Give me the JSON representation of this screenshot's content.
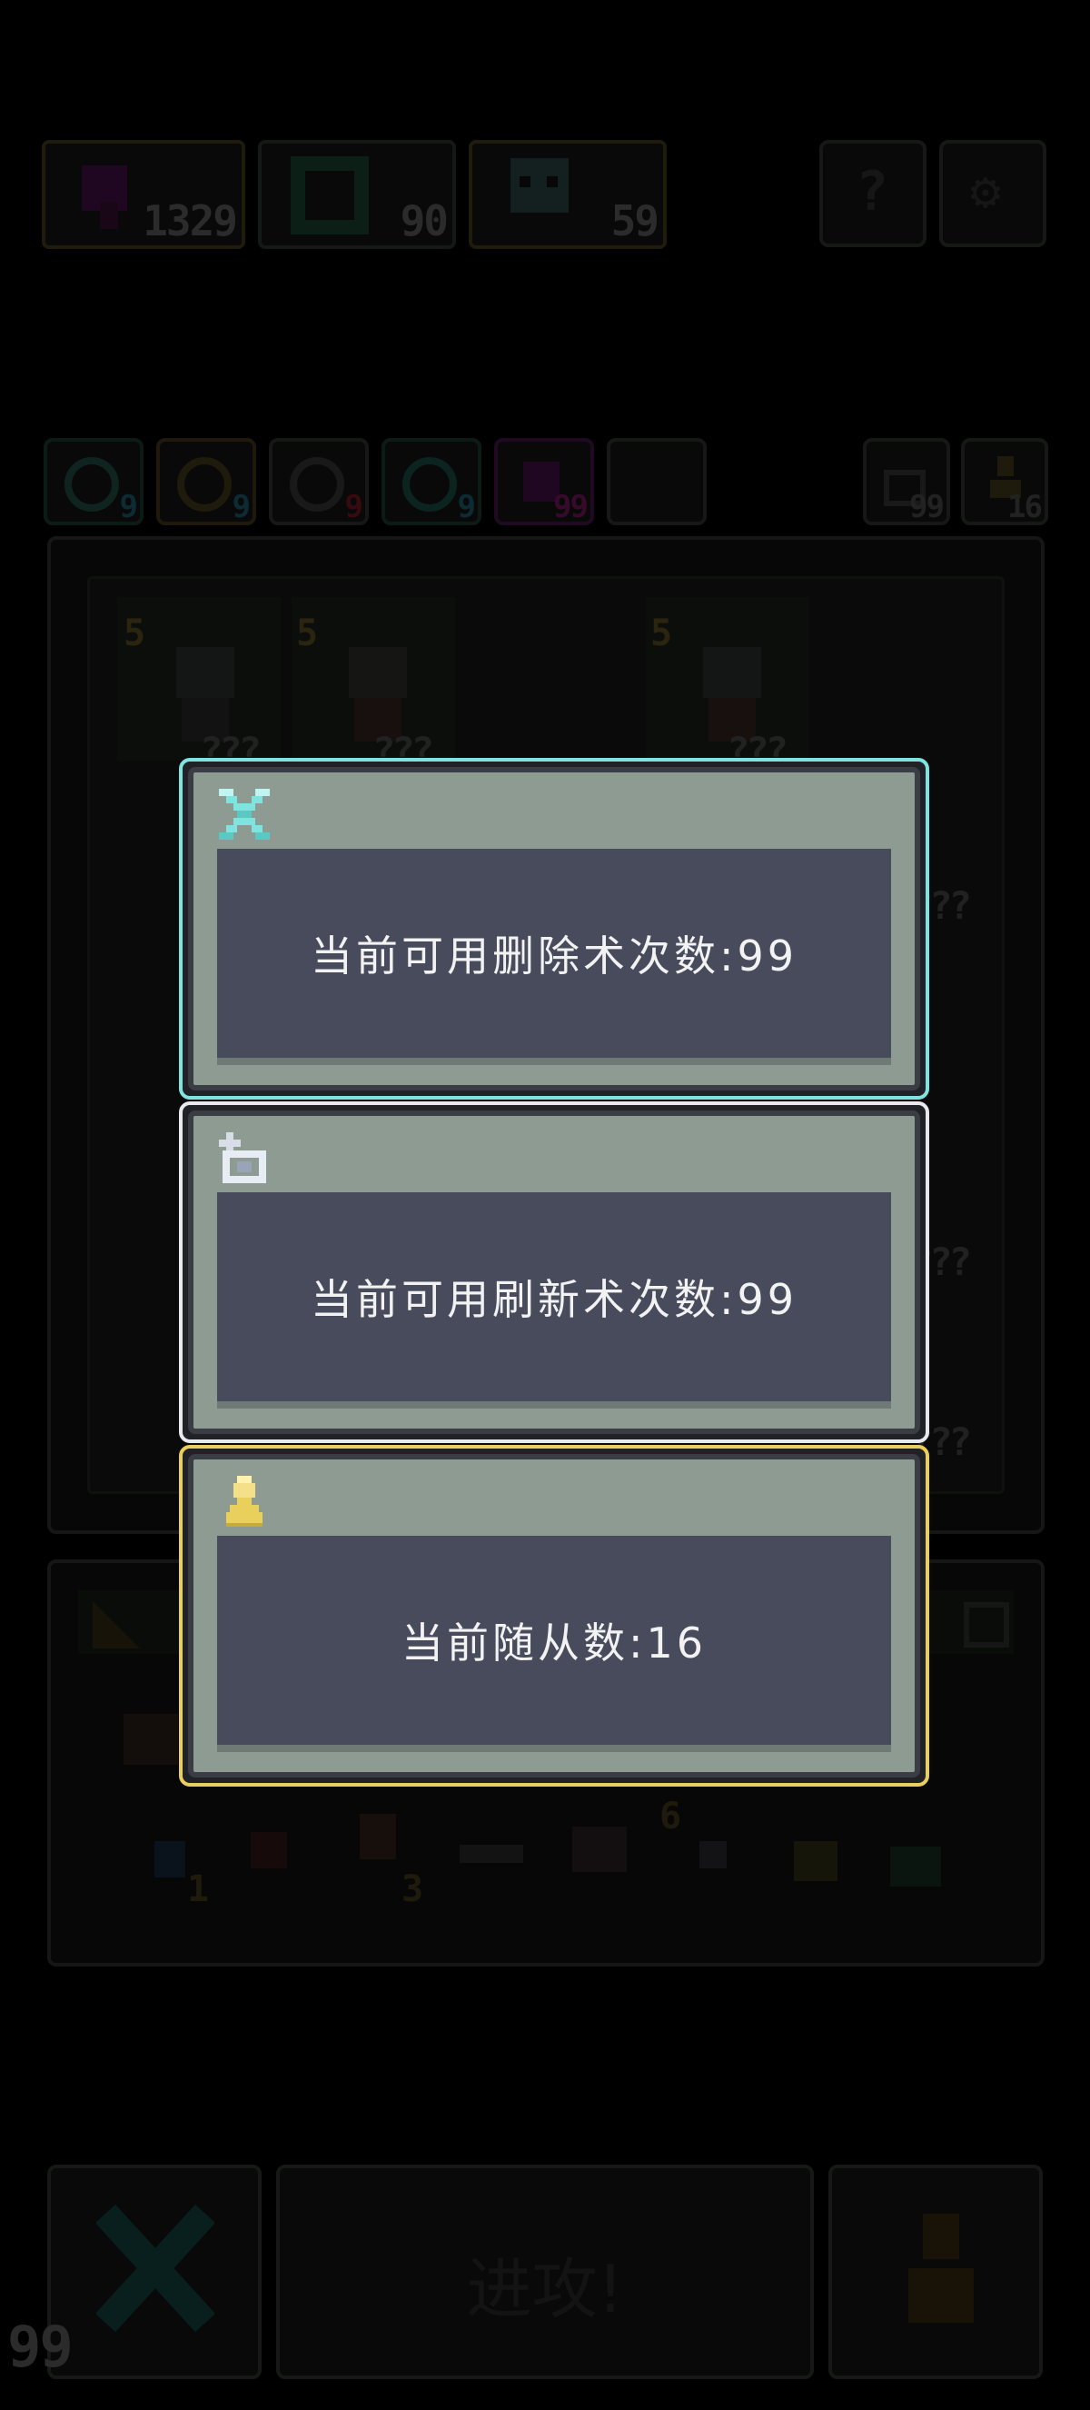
{
  "colors": {
    "delete_accent": "#7fe4e0",
    "refresh_accent": "#e8e8ee",
    "follower_accent": "#e9cf5b",
    "panel_bg": "#8e9b93",
    "screen_bg": "#474b5c"
  },
  "top_resources": [
    {
      "icon": "purple-gem-icon",
      "value": "1329"
    },
    {
      "icon": "rainbow-ring-icon",
      "value": "90"
    },
    {
      "icon": "skull-mascot-icon",
      "value": "59"
    }
  ],
  "ability_counters": [
    {
      "icon": "eye-orb-icon",
      "value": "9"
    },
    {
      "icon": "lightning-orb-icon",
      "value": "9"
    },
    {
      "icon": "spark-orb-icon",
      "value": "9"
    },
    {
      "icon": "swirl-orb-icon",
      "value": "9"
    },
    {
      "icon": "pink-gem-icon",
      "value": "99"
    }
  ],
  "side_counters": [
    {
      "icon": "refresh-icon",
      "value": "99"
    },
    {
      "icon": "follower-icon",
      "value": "16"
    }
  ],
  "board_cards": [
    {
      "level": "5",
      "stars": "???"
    },
    {
      "level": "5",
      "stars": "???"
    },
    {
      "level": "5",
      "stars": "???"
    },
    {
      "level": "",
      "stars": "???"
    },
    {
      "level": "",
      "stars": "???"
    },
    {
      "level": "",
      "stars": "???"
    }
  ],
  "item_numbers": [
    "1",
    "3",
    "6"
  ],
  "popups": [
    {
      "icon": "delete-x-icon",
      "message": "当前可用删除术次数:99"
    },
    {
      "icon": "refresh-icon",
      "message": "当前可用刷新术次数:99"
    },
    {
      "icon": "follower-pawn-icon",
      "message": "当前随从数:16"
    }
  ],
  "bottom_bar": {
    "delete_count": "99",
    "attack_label": "进攻!"
  }
}
